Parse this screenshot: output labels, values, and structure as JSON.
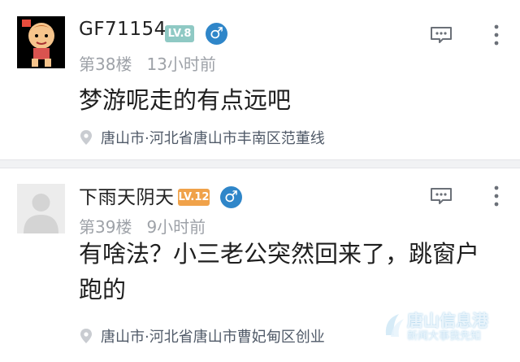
{
  "posts": [
    {
      "username": "GF71154",
      "level": "LV.8",
      "gender": "♂",
      "floor": "第38楼",
      "time": "13小时前",
      "content": "梦游呢走的有点远吧",
      "location": "唐山市·河北省唐山市丰南区范董线",
      "colors": {
        "badge": "#8fc9c4",
        "gender": "#2f86c9"
      }
    },
    {
      "username": "下雨天阴天",
      "level": "LV.12",
      "gender": "♂",
      "floor": "第39楼",
      "time": "9小时前",
      "content": "有啥法？小三老公突然回来了，跳窗户跑的",
      "location": "唐山市·河北省唐山市曹妃甸区创业",
      "colors": {
        "badge": "#f0a24a",
        "gender": "#2f86c9"
      }
    }
  ],
  "watermark": {
    "title": "唐山信息港",
    "subtitle": "新闻大事我先知"
  },
  "icons": [
    "avatar-cartoon",
    "avatar-placeholder",
    "male-icon",
    "location-pin-icon",
    "reply-icon",
    "more-vertical-icon"
  ]
}
